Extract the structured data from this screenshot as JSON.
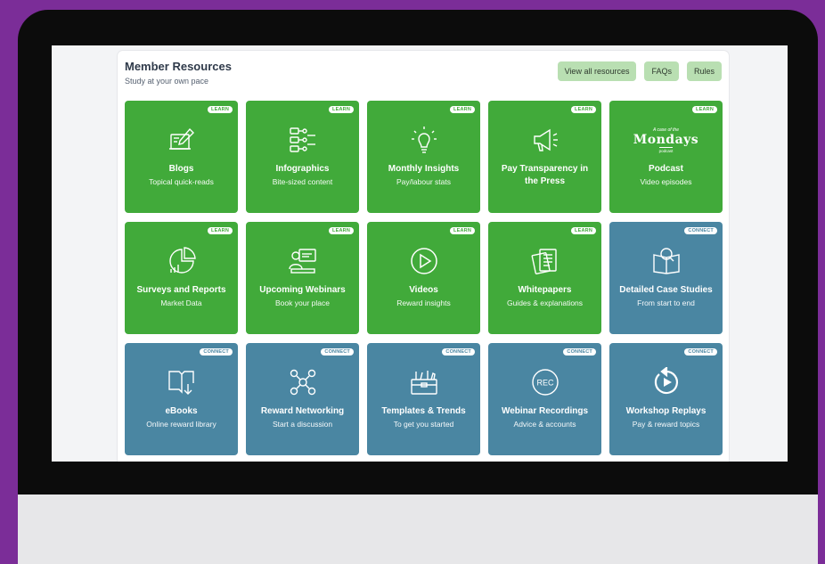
{
  "header": {
    "title": "Member Resources",
    "subtitle": "Study at your own pace"
  },
  "actions": [
    "View all resources",
    "FAQs",
    "Rules"
  ],
  "colors": {
    "background": "#7b2d98",
    "learn_tile": "#41aa3a",
    "connect_tile": "#4a86a2",
    "action_button": "#b9dfb2"
  },
  "podcast_logo": {
    "top": "A case of the",
    "main": "Mondays",
    "bottom": "podcast"
  },
  "tiles": [
    {
      "badge": "LEARN",
      "type": "learn",
      "icon": "blog-writing-icon",
      "title": "Blogs",
      "subtitle": "Topical quick-reads"
    },
    {
      "badge": "LEARN",
      "type": "learn",
      "icon": "infographic-icon",
      "title": "Infographics",
      "subtitle": "Bite-sized content"
    },
    {
      "badge": "LEARN",
      "type": "learn",
      "icon": "lightbulb-icon",
      "title": "Monthly Insights",
      "subtitle": "Pay/labour stats"
    },
    {
      "badge": "LEARN",
      "type": "learn",
      "icon": "megaphone-icon",
      "title": "Pay Transparency in the Press",
      "subtitle": ""
    },
    {
      "badge": "LEARN",
      "type": "learn",
      "icon": "mondays-podcast-logo",
      "title": "Podcast",
      "subtitle": "Video episodes"
    },
    {
      "badge": "LEARN",
      "type": "learn",
      "icon": "pie-chart-icon",
      "title": "Surveys and Reports",
      "subtitle": "Market Data"
    },
    {
      "badge": "LEARN",
      "type": "learn",
      "icon": "webinar-presenter-icon",
      "title": "Upcoming Webinars",
      "subtitle": "Book your place"
    },
    {
      "badge": "LEARN",
      "type": "learn",
      "icon": "play-circle-icon",
      "title": "Videos",
      "subtitle": "Reward insights"
    },
    {
      "badge": "LEARN",
      "type": "learn",
      "icon": "documents-icon",
      "title": "Whitepapers",
      "subtitle": "Guides & explanations"
    },
    {
      "badge": "CONNECT",
      "type": "connect",
      "icon": "case-study-book-icon",
      "title": "Detailed Case Studies",
      "subtitle": "From start to end"
    },
    {
      "badge": "CONNECT",
      "type": "connect",
      "icon": "ebook-download-icon",
      "title": "eBooks",
      "subtitle": "Online reward library"
    },
    {
      "badge": "CONNECT",
      "type": "connect",
      "icon": "network-people-icon",
      "title": "Reward Networking",
      "subtitle": "Start a discussion"
    },
    {
      "badge": "CONNECT",
      "type": "connect",
      "icon": "toolbox-icon",
      "title": "Templates & Trends",
      "subtitle": "To get you started"
    },
    {
      "badge": "CONNECT",
      "type": "connect",
      "icon": "rec-circle-icon",
      "title": "Webinar Recordings",
      "subtitle": "Advice & accounts"
    },
    {
      "badge": "CONNECT",
      "type": "connect",
      "icon": "replay-icon",
      "title": "Workshop Replays",
      "subtitle": "Pay & reward topics"
    }
  ]
}
